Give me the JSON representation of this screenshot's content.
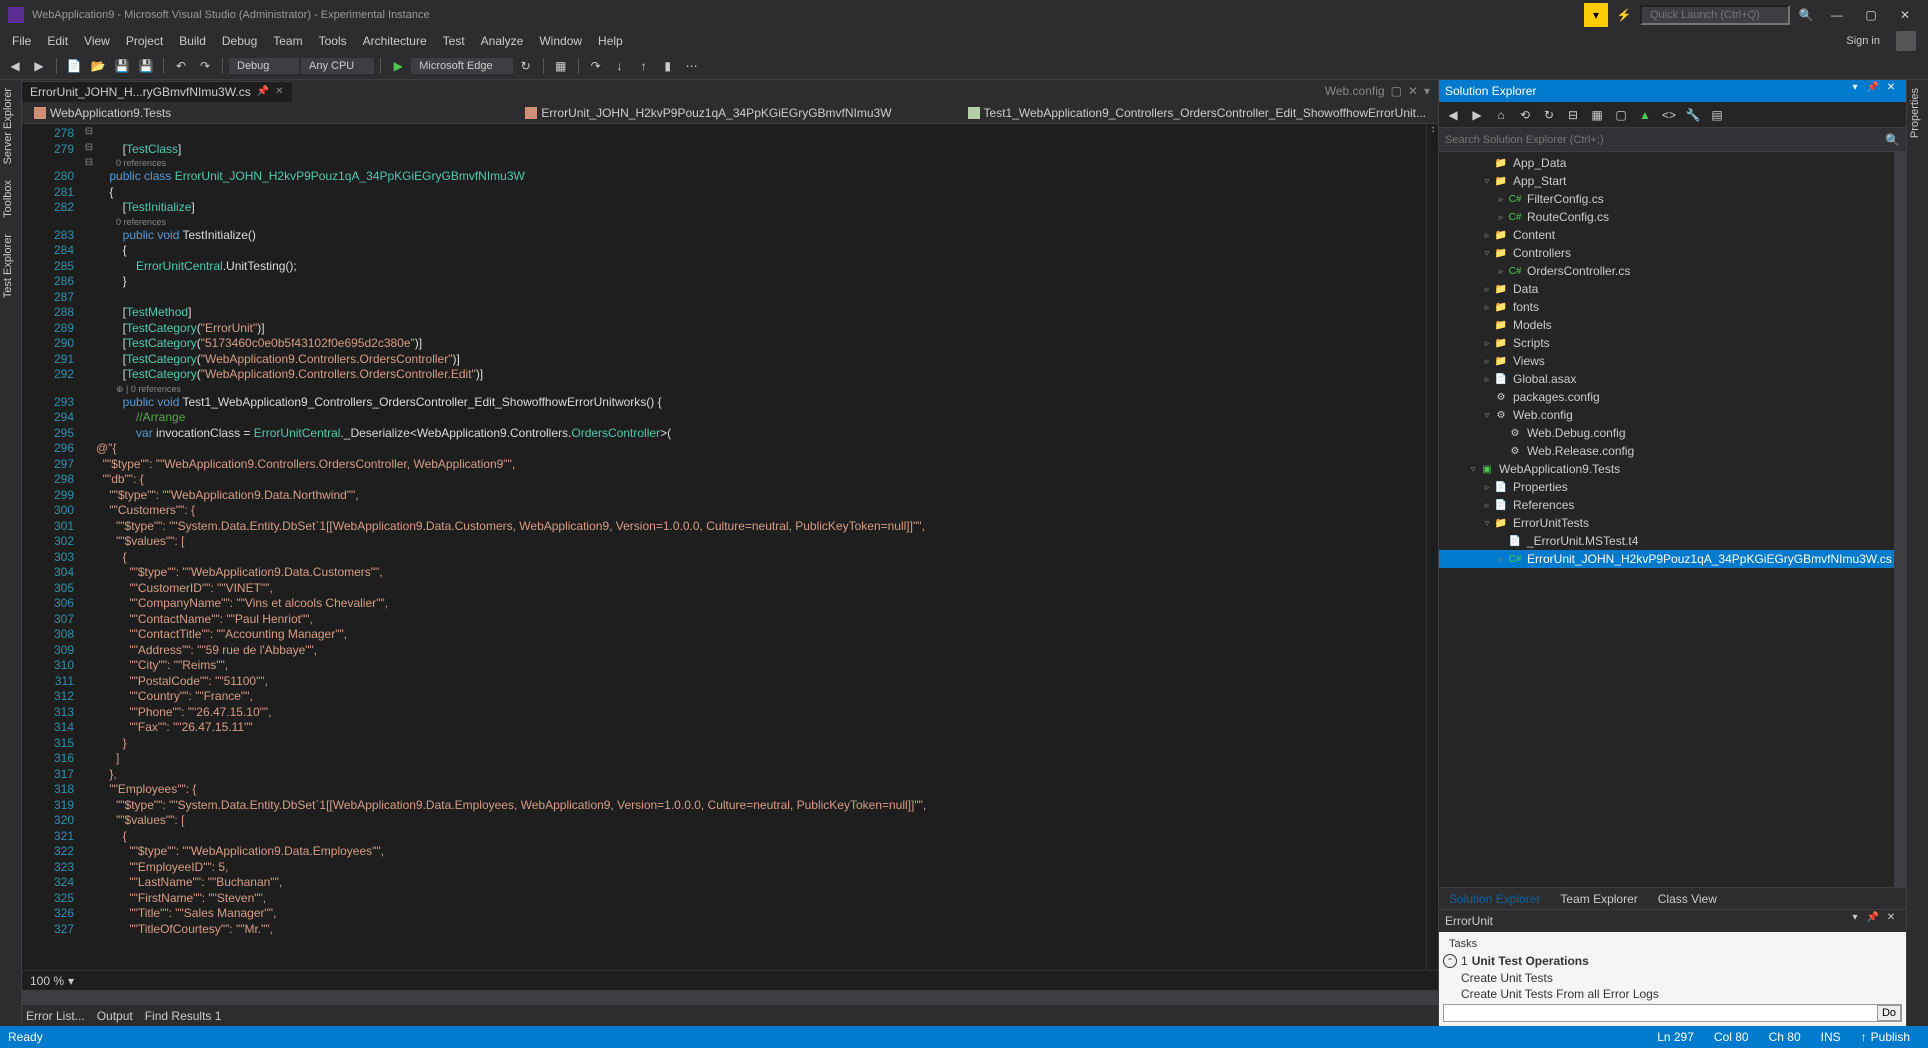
{
  "titlebar": {
    "title": "WebApplication9 - Microsoft Visual Studio (Administrator) - Experimental Instance",
    "quick_launch_placeholder": "Quick Launch (Ctrl+Q)"
  },
  "menu": [
    "File",
    "Edit",
    "View",
    "Project",
    "Build",
    "Debug",
    "Team",
    "Tools",
    "Architecture",
    "Test",
    "Analyze",
    "Window",
    "Help"
  ],
  "signin": "Sign in",
  "toolbar": {
    "config": "Debug",
    "platform": "Any CPU",
    "browser": "Microsoft Edge"
  },
  "left_tabs": [
    "Server Explorer",
    "Toolbox",
    "Test Explorer"
  ],
  "right_side_tab": "Properties",
  "doc_tabs": {
    "active": "ErrorUnit_JOHN_H...ryGBmvfNImu3W.cs",
    "right": "Web.config"
  },
  "navbar": {
    "project": "WebApplication9.Tests",
    "class": "ErrorUnit_JOHN_H2kvP9Pouz1qA_34PpKGiEGryGBmvfNImu3W",
    "method": "Test1_WebApplication9_Controllers_OrdersController_Edit_ShowoffhowErrorUnit..."
  },
  "code_lines": [
    {
      "n": 278,
      "t": ""
    },
    {
      "n": 279,
      "t": "        [<type>TestClass</type>]"
    },
    {
      "n": null,
      "t": "        <ref>0 references</ref>"
    },
    {
      "n": 280,
      "t": "    <kw>public</kw> <kw>class</kw> <type>ErrorUnit_JOHN_H2kvP9Pouz1qA_34PpKGiEGryGBmvfNImu3W</type>"
    },
    {
      "n": 281,
      "t": "    {"
    },
    {
      "n": 282,
      "t": "        [<type>TestInitialize</type>]"
    },
    {
      "n": null,
      "t": "        <ref>0 references</ref>"
    },
    {
      "n": 283,
      "t": "        <kw>public</kw> <kw>void</kw> TestInitialize()"
    },
    {
      "n": 284,
      "t": "        {"
    },
    {
      "n": 285,
      "t": "            <type>ErrorUnitCentral</type>.UnitTesting();"
    },
    {
      "n": 286,
      "t": "        }"
    },
    {
      "n": 287,
      "t": ""
    },
    {
      "n": 288,
      "t": "        [<type>TestMethod</type>]"
    },
    {
      "n": 289,
      "t": "        [<type>TestCategory</type>(<str>\"ErrorUnit\"</str>)]"
    },
    {
      "n": 290,
      "t": "        [<type>TestCategory</type>(<str>\"5173460c0e0b5f43102f0e695d2c380e\"</str>)]"
    },
    {
      "n": 291,
      "t": "        [<type>TestCategory</type>(<str>\"WebApplication9.Controllers.OrdersController\"</str>)]"
    },
    {
      "n": 292,
      "t": "        [<type>TestCategory</type>(<str>\"WebApplication9.Controllers.OrdersController.Edit\"</str>)]"
    },
    {
      "n": null,
      "t": "        <ref>⊕ | 0 references</ref>"
    },
    {
      "n": 293,
      "t": "        <kw>public</kw> <kw>void</kw> Test1_WebApplication9_Controllers_OrdersController_Edit_ShowoffhowErrorUnitworks() {"
    },
    {
      "n": 294,
      "t": "            <cmt>//Arrange</cmt>"
    },
    {
      "n": 295,
      "t": "            <kw>var</kw> invocationClass = <type>ErrorUnitCentral</type>._Deserialize&lt;WebApplication9.Controllers.<type>OrdersController</type>&gt;("
    },
    {
      "n": 296,
      "t": "<str>@\"{</str>"
    },
    {
      "n": 297,
      "t": "<str>  \"\"$type\"\": \"\"WebApplication9.Controllers.OrdersController, WebApplication9\"\",</str>"
    },
    {
      "n": 298,
      "t": "<str>  \"\"db\"\": {</str>"
    },
    {
      "n": 299,
      "t": "<str>    \"\"$type\"\": \"\"WebApplication9.Data.Northwind\"\",</str>"
    },
    {
      "n": 300,
      "t": "<str>    \"\"Customers\"\": {</str>"
    },
    {
      "n": 301,
      "t": "<str>      \"\"$type\"\": \"\"System.Data.Entity.DbSet`1[[WebApplication9.Data.Customers, WebApplication9, Version=1.0.0.0, Culture=neutral, PublicKeyToken=null]]\"\",</str>"
    },
    {
      "n": 302,
      "t": "<str>      \"\"$values\"\": [</str>"
    },
    {
      "n": 303,
      "t": "<str>        {</str>"
    },
    {
      "n": 304,
      "t": "<str>          \"\"$type\"\": \"\"WebApplication9.Data.Customers\"\",</str>"
    },
    {
      "n": 305,
      "t": "<str>          \"\"CustomerID\"\": \"\"VINET\"\",</str>"
    },
    {
      "n": 306,
      "t": "<str>          \"\"CompanyName\"\": \"\"Vins et alcools Chevalier\"\",</str>"
    },
    {
      "n": 307,
      "t": "<str>          \"\"ContactName\"\": \"\"Paul Henriot\"\",</str>"
    },
    {
      "n": 308,
      "t": "<str>          \"\"ContactTitle\"\": \"\"Accounting Manager\"\",</str>"
    },
    {
      "n": 309,
      "t": "<str>          \"\"Address\"\": \"\"59 rue de l'Abbaye\"\",</str>"
    },
    {
      "n": 310,
      "t": "<str>          \"\"City\"\": \"\"Reims\"\",</str>"
    },
    {
      "n": 311,
      "t": "<str>          \"\"PostalCode\"\": \"\"51100\"\",</str>"
    },
    {
      "n": 312,
      "t": "<str>          \"\"Country\"\": \"\"France\"\",</str>"
    },
    {
      "n": 313,
      "t": "<str>          \"\"Phone\"\": \"\"26.47.15.10\"\",</str>"
    },
    {
      "n": 314,
      "t": "<str>          \"\"Fax\"\": \"\"26.47.15.11\"\"</str>"
    },
    {
      "n": 315,
      "t": "<str>        }</str>"
    },
    {
      "n": 316,
      "t": "<str>      ]</str>"
    },
    {
      "n": 317,
      "t": "<str>    },</str>"
    },
    {
      "n": 318,
      "t": "<str>    \"\"Employees\"\": {</str>"
    },
    {
      "n": 319,
      "t": "<str>      \"\"$type\"\": \"\"System.Data.Entity.DbSet`1[[WebApplication9.Data.Employees, WebApplication9, Version=1.0.0.0, Culture=neutral, PublicKeyToken=null]]\"\",</str>"
    },
    {
      "n": 320,
      "t": "<str>      \"\"$values\"\": [</str>"
    },
    {
      "n": 321,
      "t": "<str>        {</str>"
    },
    {
      "n": 322,
      "t": "<str>          \"\"$type\"\": \"\"WebApplication9.Data.Employees\"\",</str>"
    },
    {
      "n": 323,
      "t": "<str>          \"\"EmployeeID\"\": 5,</str>"
    },
    {
      "n": 324,
      "t": "<str>          \"\"LastName\"\": \"\"Buchanan\"\",</str>"
    },
    {
      "n": 325,
      "t": "<str>          \"\"FirstName\"\": \"\"Steven\"\",</str>"
    },
    {
      "n": 326,
      "t": "<str>          \"\"Title\"\": \"\"Sales Manager\"\",</str>"
    },
    {
      "n": 327,
      "t": "<str>          \"\"TitleOfCourtesy\"\": \"\"Mr.\"\",</str>"
    }
  ],
  "zoom": "100 %",
  "output_tabs": [
    "Error List...",
    "Output",
    "Find Results 1"
  ],
  "solution_explorer": {
    "title": "Solution Explorer",
    "search_placeholder": "Search Solution Explorer (Ctrl+;)",
    "tree": [
      {
        "depth": 3,
        "arrow": "",
        "icon": "folder",
        "label": "App_Data"
      },
      {
        "depth": 3,
        "arrow": "▿",
        "icon": "folder",
        "label": "App_Start"
      },
      {
        "depth": 4,
        "arrow": "▹",
        "icon": "cs",
        "label": "FilterConfig.cs"
      },
      {
        "depth": 4,
        "arrow": "▹",
        "icon": "cs",
        "label": "RouteConfig.cs"
      },
      {
        "depth": 3,
        "arrow": "▹",
        "icon": "folder",
        "label": "Content"
      },
      {
        "depth": 3,
        "arrow": "▿",
        "icon": "folder",
        "label": "Controllers"
      },
      {
        "depth": 4,
        "arrow": "▹",
        "icon": "cs",
        "label": "OrdersController.cs"
      },
      {
        "depth": 3,
        "arrow": "▹",
        "icon": "folder",
        "label": "Data"
      },
      {
        "depth": 3,
        "arrow": "▹",
        "icon": "folder",
        "label": "fonts"
      },
      {
        "depth": 3,
        "arrow": "",
        "icon": "folder",
        "label": "Models"
      },
      {
        "depth": 3,
        "arrow": "▹",
        "icon": "folder",
        "label": "Scripts"
      },
      {
        "depth": 3,
        "arrow": "▹",
        "icon": "folder",
        "label": "Views"
      },
      {
        "depth": 3,
        "arrow": "▹",
        "icon": "file",
        "label": "Global.asax"
      },
      {
        "depth": 3,
        "arrow": "",
        "icon": "config",
        "label": "packages.config"
      },
      {
        "depth": 3,
        "arrow": "▿",
        "icon": "config",
        "label": "Web.config"
      },
      {
        "depth": 4,
        "arrow": "",
        "icon": "config",
        "label": "Web.Debug.config"
      },
      {
        "depth": 4,
        "arrow": "",
        "icon": "config",
        "label": "Web.Release.config"
      },
      {
        "depth": 2,
        "arrow": "▿",
        "icon": "proj",
        "label": "WebApplication9.Tests"
      },
      {
        "depth": 3,
        "arrow": "▹",
        "icon": "file",
        "label": "Properties"
      },
      {
        "depth": 3,
        "arrow": "▹",
        "icon": "file",
        "label": "References"
      },
      {
        "depth": 3,
        "arrow": "▿",
        "icon": "folder",
        "label": "ErrorUnitTests"
      },
      {
        "depth": 4,
        "arrow": "",
        "icon": "file",
        "label": "_ErrorUnit.MSTest.t4"
      },
      {
        "depth": 4,
        "arrow": "▹",
        "icon": "cs",
        "label": "ErrorUnit_JOHN_H2kvP9Pouz1qA_34PpKGiEGryGBmvfNImu3W.cs",
        "selected": true
      }
    ],
    "tabs": [
      "Solution Explorer",
      "Team Explorer",
      "Class View"
    ]
  },
  "error_unit": {
    "title": "ErrorUnit",
    "tasks_label": "Tasks",
    "group_num": "1",
    "group_label": "Unit Test Operations",
    "item1": "Create Unit Tests",
    "item2": "Create Unit Tests From all Error Logs",
    "do_btn": "Do"
  },
  "status": {
    "ready": "Ready",
    "ln": "Ln 297",
    "col": "Col 80",
    "ch": "Ch 80",
    "ins": "INS",
    "publish": "Publish"
  }
}
